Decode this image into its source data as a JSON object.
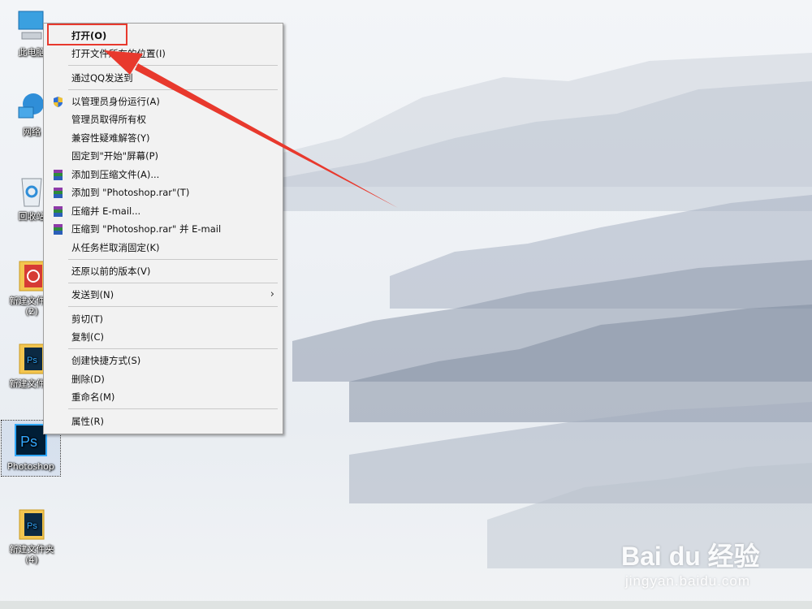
{
  "desktop": {
    "icons": [
      {
        "label": "此电脑",
        "icon": "computer-icon"
      },
      {
        "label": "网络",
        "icon": "network-icon"
      },
      {
        "label": "回收站",
        "icon": "recycle-bin-icon"
      },
      {
        "label": "新建文件夹 (2)",
        "icon": "netease-folder-icon"
      },
      {
        "label": "新建文件夹",
        "icon": "ps-folder-icon"
      },
      {
        "label": "Photoshop",
        "icon": "photoshop-icon"
      },
      {
        "label": "新建文件夹 (4)",
        "icon": "ps-folder-icon"
      }
    ]
  },
  "context_menu": {
    "items": [
      {
        "label": "打开(O)"
      },
      {
        "label": "打开文件所在的位置(I)"
      },
      {
        "label": "通过QQ发送到"
      },
      {
        "label": "以管理员身份运行(A)",
        "icon": "uac-shield-icon"
      },
      {
        "label": "管理员取得所有权"
      },
      {
        "label": "兼容性疑难解答(Y)"
      },
      {
        "label": "固定到\"开始\"屏幕(P)"
      },
      {
        "label": "添加到压缩文件(A)...",
        "icon": "winrar-icon"
      },
      {
        "label": "添加到 \"Photoshop.rar\"(T)",
        "icon": "winrar-icon"
      },
      {
        "label": "压缩并 E-mail...",
        "icon": "winrar-icon"
      },
      {
        "label": "压缩到 \"Photoshop.rar\" 并 E-mail",
        "icon": "winrar-icon"
      },
      {
        "label": "从任务栏取消固定(K)"
      },
      {
        "label": "还原以前的版本(V)"
      },
      {
        "label": "发送到(N)",
        "submenu_arrow": "›"
      },
      {
        "label": "剪切(T)"
      },
      {
        "label": "复制(C)"
      },
      {
        "label": "创建快捷方式(S)"
      },
      {
        "label": "删除(D)"
      },
      {
        "label": "重命名(M)"
      },
      {
        "label": "属性(R)"
      }
    ]
  },
  "annotation": {
    "color": "#e8392d",
    "icon": "red-arrow"
  },
  "watermark": {
    "brand": "Bai du 经验",
    "url": "jingyan.baidu.com"
  }
}
